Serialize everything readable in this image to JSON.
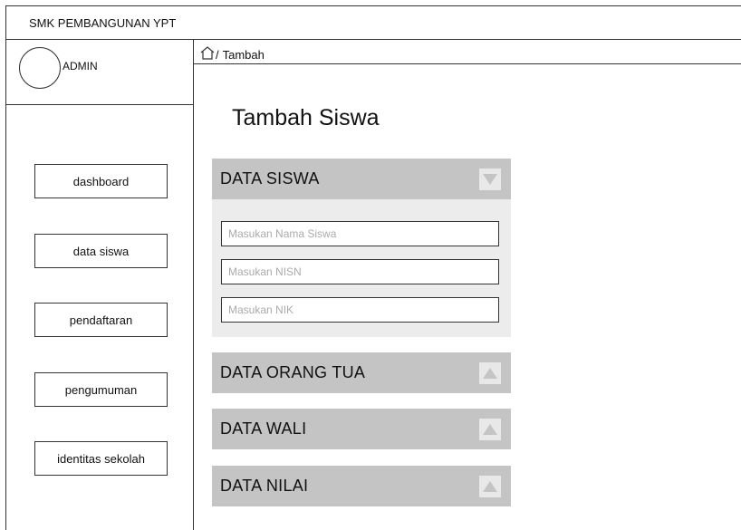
{
  "app": {
    "title": "SMK PEMBANGUNAN YPT"
  },
  "profile": {
    "name": "ADMIN"
  },
  "sidebar": {
    "items": [
      {
        "label": "dashboard"
      },
      {
        "label": "data siswa"
      },
      {
        "label": "pendaftaran"
      },
      {
        "label": "pengumuman"
      },
      {
        "label": "identitas sekolah"
      }
    ]
  },
  "breadcrumb": {
    "separator": "/",
    "current": "Tambah",
    "icon": "home-icon"
  },
  "main": {
    "title": "Tambah Siswa",
    "sections": [
      {
        "label": "DATA SISWA",
        "state": "expanded",
        "icon": "chevron-down-icon"
      },
      {
        "label": "DATA ORANG TUA",
        "state": "collapsed",
        "icon": "chevron-up-icon"
      },
      {
        "label": "DATA WALI",
        "state": "collapsed",
        "icon": "chevron-up-icon"
      },
      {
        "label": "DATA NILAI",
        "state": "collapsed",
        "icon": "chevron-up-icon"
      }
    ],
    "form": {
      "nama": {
        "value": "",
        "placeholder": "Masukan Nama Siswa"
      },
      "nisn": {
        "value": "",
        "placeholder": "Masukan NISN"
      },
      "nik": {
        "value": "",
        "placeholder": "Masukan NIK"
      }
    }
  },
  "colors": {
    "section_header": "#c4c4c4",
    "form_panel": "#ececec",
    "toggle_bg": "#e8e8e8",
    "border": "#333333"
  }
}
